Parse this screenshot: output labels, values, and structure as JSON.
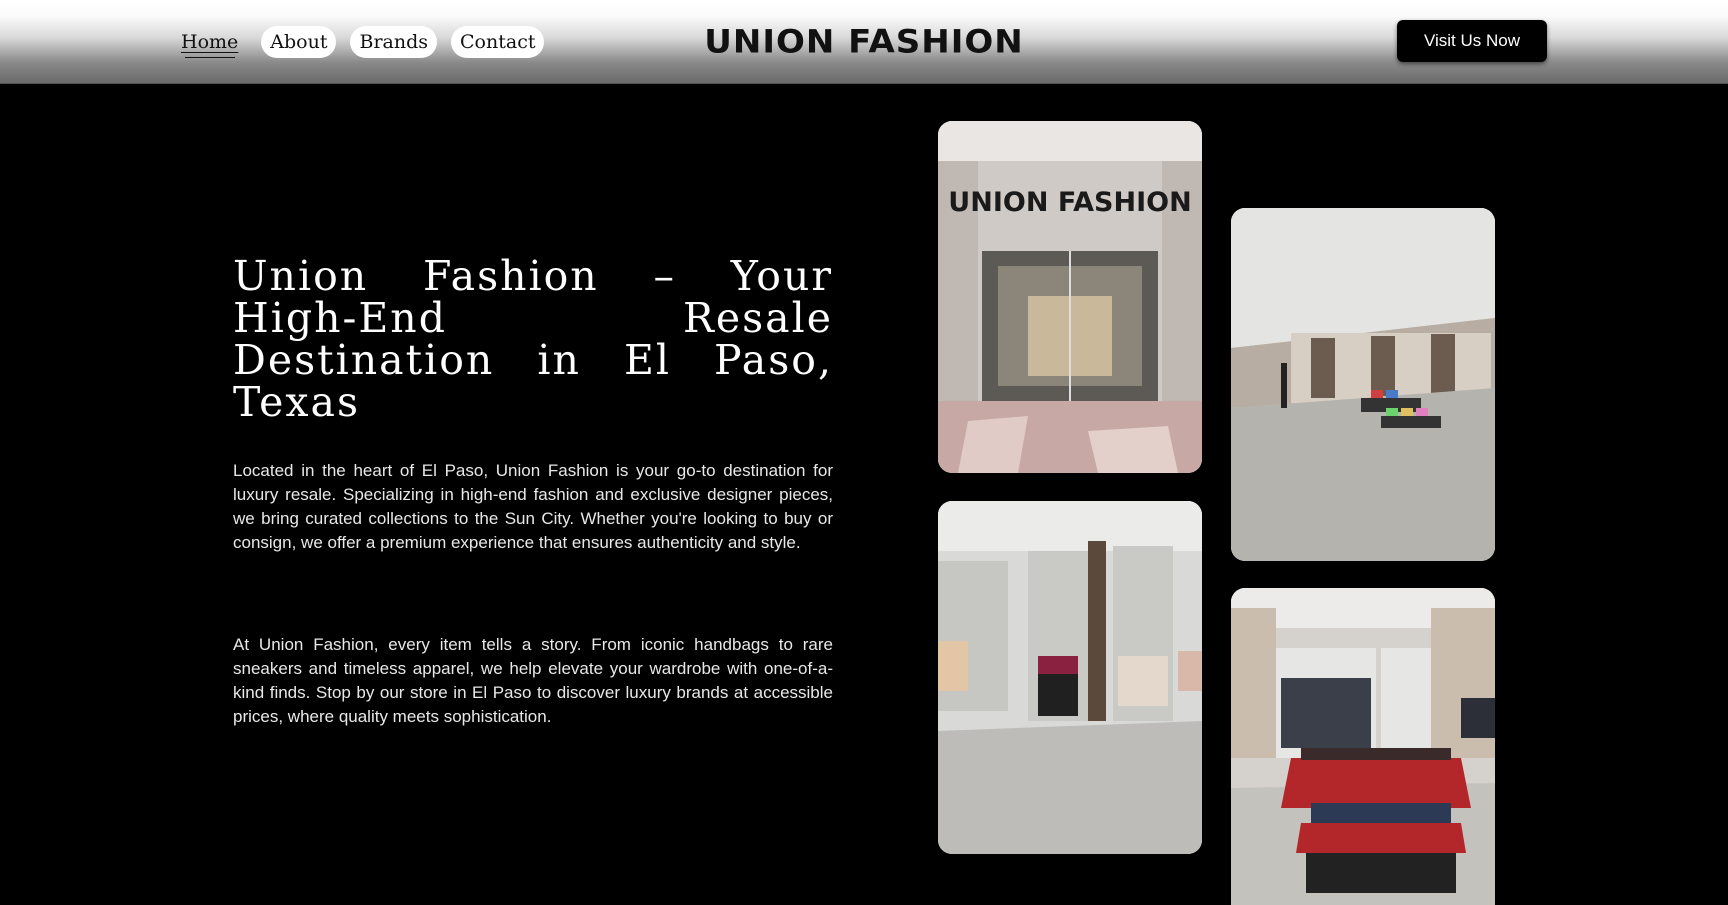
{
  "header": {
    "nav": [
      {
        "label": "Home",
        "active": true
      },
      {
        "label": "About"
      },
      {
        "label": "Brands"
      },
      {
        "label": "Contact"
      }
    ],
    "logo": "UNION FASHION",
    "cta_label": "Visit Us Now"
  },
  "hero": {
    "title": "Union Fashion – Your High-End Resale Destination in El Paso, Texas",
    "paragraph1": "Located in the heart of El Paso, Union Fashion is your go-to destination for luxury resale. Specializing in high-end fashion and exclusive designer pieces, we bring curated collections to the Sun City. Whether you're looking to buy or consign, we offer a premium experience that ensures authenticity and style.",
    "paragraph2": "At Union Fashion, every item tells a story. From iconic handbags to rare sneakers and timeless apparel, we help elevate your wardrobe with one-of-a-kind finds. Stop by our store in El Paso to discover luxury brands at accessible prices, where quality meets sophistication."
  },
  "gallery": {
    "storefront_sign": "UNION FASHION"
  },
  "colors": {
    "background": "#000000",
    "text": "#ffffff",
    "cta_bg": "#000000",
    "shelf_red": "#b3262a"
  }
}
